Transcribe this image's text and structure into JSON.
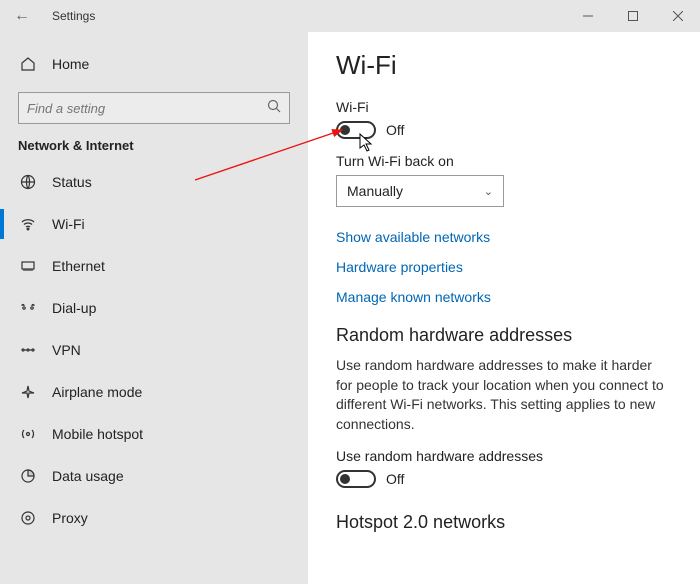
{
  "window": {
    "title": "Settings"
  },
  "sidebar": {
    "home": "Home",
    "search_placeholder": "Find a setting",
    "section": "Network & Internet",
    "items": [
      {
        "label": "Status"
      },
      {
        "label": "Wi-Fi"
      },
      {
        "label": "Ethernet"
      },
      {
        "label": "Dial-up"
      },
      {
        "label": "VPN"
      },
      {
        "label": "Airplane mode"
      },
      {
        "label": "Mobile hotspot"
      },
      {
        "label": "Data usage"
      },
      {
        "label": "Proxy"
      }
    ]
  },
  "content": {
    "title": "Wi-Fi",
    "wifi_label": "Wi-Fi",
    "wifi_state": "Off",
    "back_on_label": "Turn Wi-Fi back on",
    "back_on_value": "Manually",
    "links": {
      "show_networks": "Show available networks",
      "hw_props": "Hardware properties",
      "manage_known": "Manage known networks"
    },
    "random_hw": {
      "heading": "Random hardware addresses",
      "desc": "Use random hardware addresses to make it harder for people to track your location when you connect to different Wi-Fi networks. This setting applies to new connections.",
      "toggle_label": "Use random hardware addresses",
      "toggle_state": "Off"
    },
    "hotspot_heading": "Hotspot 2.0 networks"
  }
}
